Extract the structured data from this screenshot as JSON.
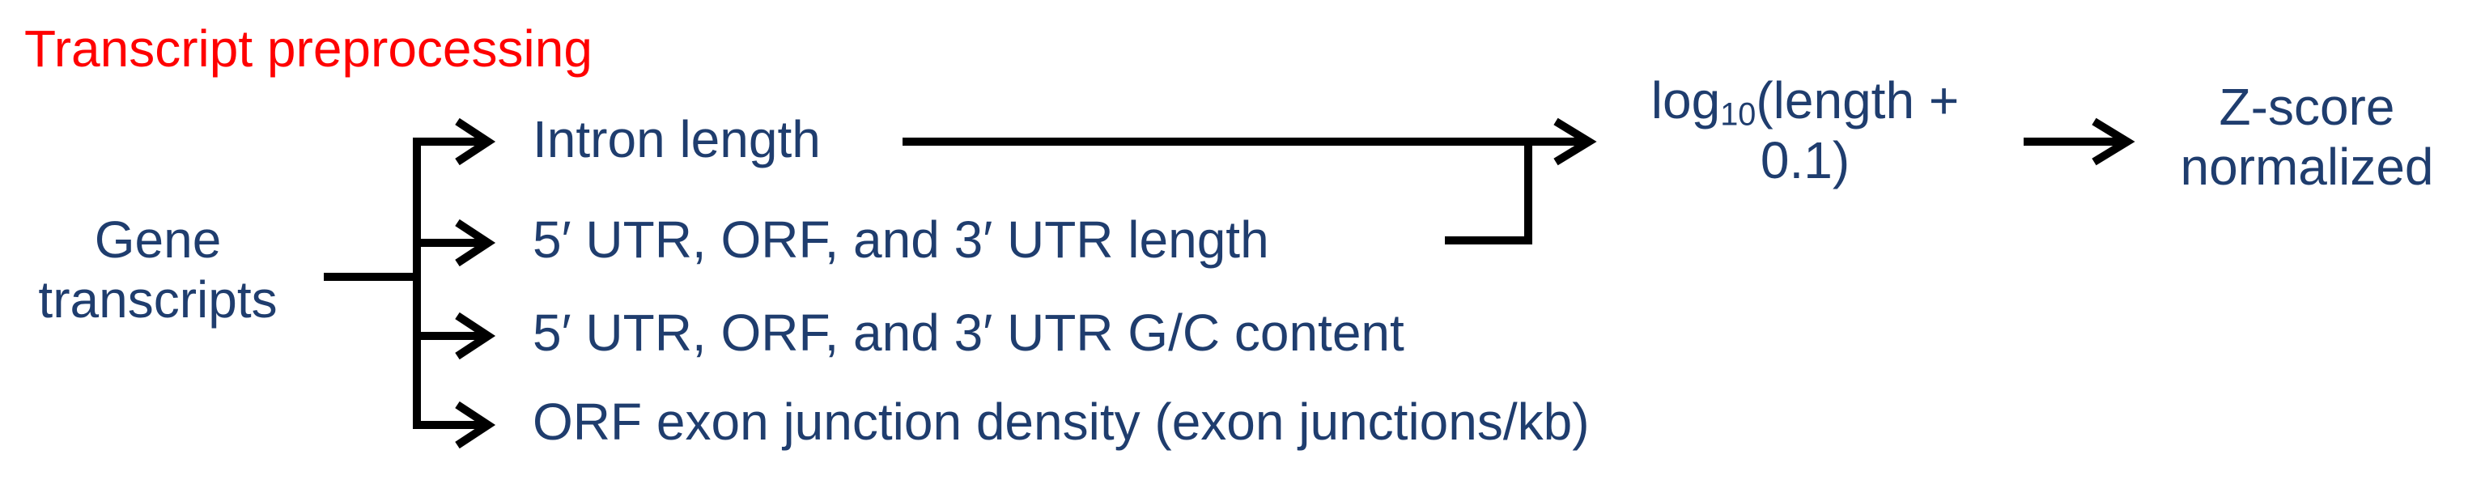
{
  "title": "Transcript preprocessing",
  "source": {
    "line1": "Gene",
    "line2": "transcripts"
  },
  "features": [
    "Intron length",
    "5′ UTR, ORF, and 3′ UTR length",
    "5′ UTR, ORF, and 3′ UTR G/C content",
    "ORF exon junction density (exon junctions/kb)"
  ],
  "log_transform": {
    "prefix": "log",
    "subscript": "10",
    "suffix": "(length +",
    "line2": "0.1)"
  },
  "normalization": {
    "line1": "Z-score",
    "line2": "normalized"
  },
  "colors": {
    "title": "#ff0000",
    "text": "#1f3d6e",
    "arrows": "#000000"
  }
}
